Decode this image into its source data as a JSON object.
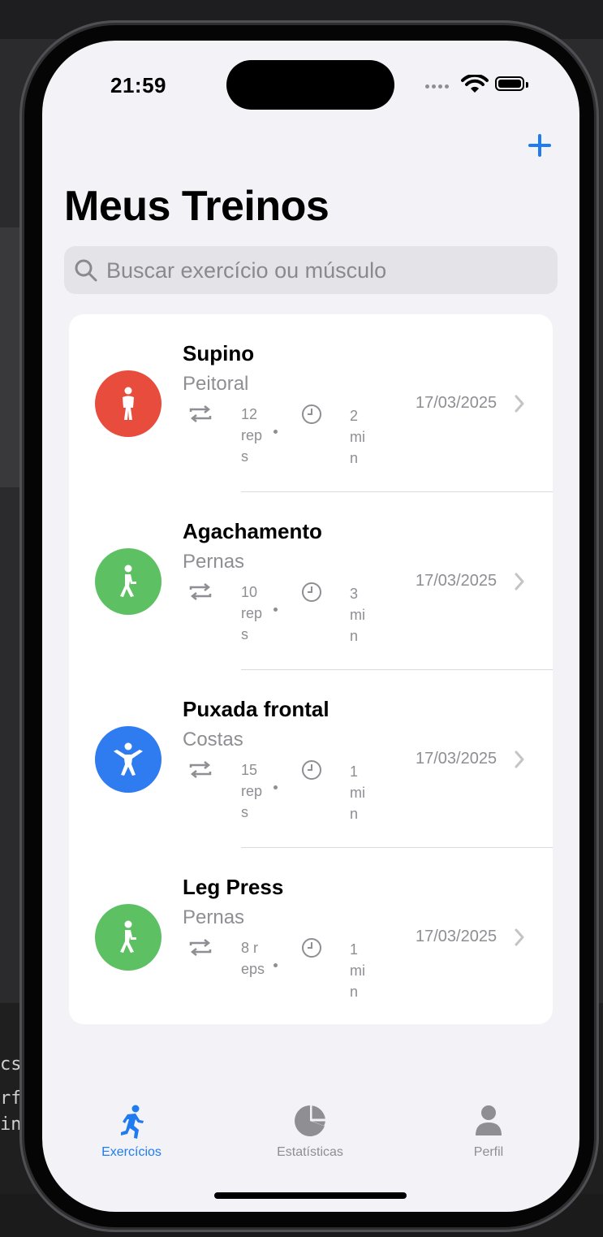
{
  "background": {
    "code_lines": [
      "cs",
      "rf",
      "in"
    ]
  },
  "status_bar": {
    "time": "21:59"
  },
  "header": {
    "title": "Meus Treinos"
  },
  "search": {
    "placeholder": "Buscar exercício ou músculo",
    "value": ""
  },
  "exercises": [
    {
      "name": "Supino",
      "muscle": "Peitoral",
      "reps": "12 reps",
      "time": "2 min",
      "date": "17/03/2025",
      "color": "#e84c3d",
      "icon": "figure-stand-icon"
    },
    {
      "name": "Agachamento",
      "muscle": "Pernas",
      "reps": "10 reps",
      "time": "3 min",
      "date": "17/03/2025",
      "color": "#5dc063",
      "icon": "figure-walk-icon"
    },
    {
      "name": "Puxada frontal",
      "muscle": "Costas",
      "reps": "15 reps",
      "time": "1 min",
      "date": "17/03/2025",
      "color": "#2f7bf0",
      "icon": "figure-arms-open-icon"
    },
    {
      "name": "Leg Press",
      "muscle": "Pernas",
      "reps": "8 reps",
      "time": "1 min",
      "date": "17/03/2025",
      "color": "#5dc063",
      "icon": "figure-walk-icon"
    }
  ],
  "tabs": [
    {
      "label": "Exercícios",
      "icon": "figure-run-icon",
      "active": true
    },
    {
      "label": "Estatísticas",
      "icon": "pie-chart-icon",
      "active": false
    },
    {
      "label": "Perfil",
      "icon": "person-icon",
      "active": false
    }
  ],
  "colors": {
    "accent": "#1f7cf0",
    "inactive": "#8e8e93",
    "background": "#f2f2f7"
  }
}
